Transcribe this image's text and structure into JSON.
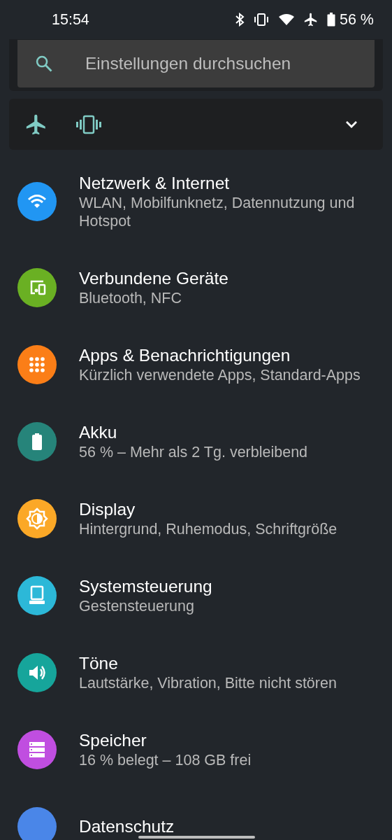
{
  "status_bar": {
    "time": "15:54",
    "battery_text": "56 %"
  },
  "search": {
    "placeholder": "Einstellungen durchsuchen"
  },
  "items": [
    {
      "title": "Netzwerk & Internet",
      "subtitle": "WLAN, Mobilfunknetz, Datennutzung und Hotspot",
      "kind": "wifi",
      "color": "#2196f3"
    },
    {
      "title": "Verbundene Geräte",
      "subtitle": "Bluetooth, NFC",
      "kind": "devices",
      "color": "#6ab023"
    },
    {
      "title": "Apps & Benachrichtigungen",
      "subtitle": "Kürzlich verwendete Apps, Standard-Apps",
      "kind": "apps",
      "color": "#fb7e17"
    },
    {
      "title": "Akku",
      "subtitle": "56 % – Mehr als 2 Tg. verbleibend",
      "kind": "battery",
      "color": "#26847a"
    },
    {
      "title": "Display",
      "subtitle": "Hintergrund, Ruhemodus, Schriftgröße",
      "kind": "display",
      "color": "#fba827"
    },
    {
      "title": "Systemsteuerung",
      "subtitle": "Gestensteuerung",
      "kind": "system",
      "color": "#2cb8d8"
    },
    {
      "title": "Töne",
      "subtitle": "Lautstärke, Vibration, Bitte nicht stören",
      "kind": "sound",
      "color": "#16a59b"
    },
    {
      "title": "Speicher",
      "subtitle": "16 % belegt – 108 GB frei",
      "kind": "storage",
      "color": "#c04ee0"
    },
    {
      "title": "Datenschutz",
      "kind": "privacy",
      "color": "#4a86e8"
    }
  ]
}
